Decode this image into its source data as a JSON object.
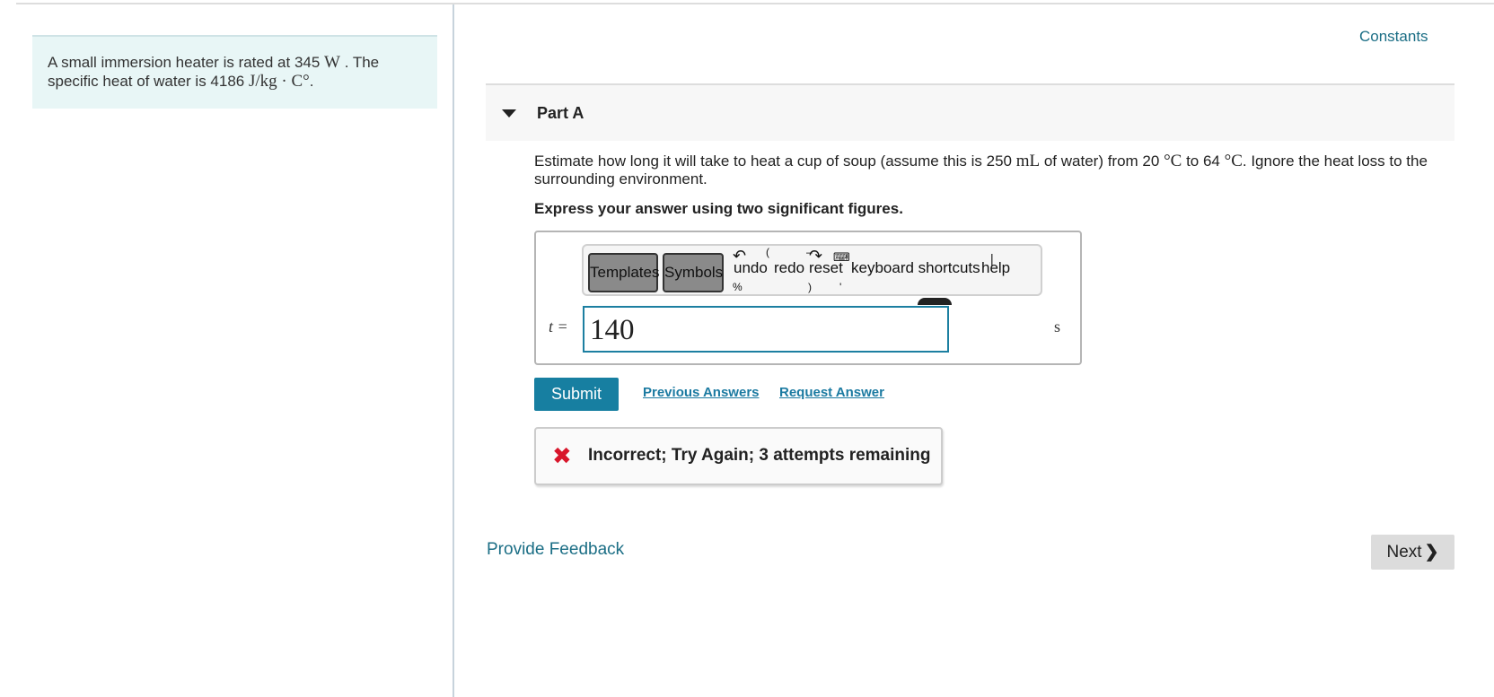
{
  "problem": {
    "pre": "A small immersion heater is rated at 345 ",
    "power_unit": "W",
    "mid": " . The specific heat of water is 4186 ",
    "heat_unit": "J/kg · C°",
    "end": "."
  },
  "constants_link": "Constants",
  "part": {
    "title": "Part A",
    "question": {
      "t1": "Estimate how long it will take to heat a cup of soup (assume this is 250 ",
      "u1": "mL",
      "t2": " of water) from 20 ",
      "u2": "°C",
      "t3": " to 64 ",
      "u3": "°C",
      "t4": ". Ignore the heat loss to the surrounding environment."
    },
    "instructions": "Express your answer using two significant figures."
  },
  "toolbar": {
    "templates": "Templates",
    "symbols": "Symbols",
    "undo": "undo",
    "redo": "redo",
    "reset": "reset",
    "keyboard": "keyboard shortcuts",
    "help": "help"
  },
  "answer": {
    "variable": "t =",
    "value": "140",
    "unit": "s"
  },
  "actions": {
    "submit": "Submit",
    "previous": "Previous Answers",
    "request": "Request Answer"
  },
  "feedback": {
    "message": "Incorrect; Try Again; 3 attempts remaining",
    "icon": "x-mark-icon",
    "icon_color": "#d8162b"
  },
  "footer": {
    "provide_feedback": "Provide Feedback",
    "next": "Next"
  },
  "colors": {
    "accent": "#177fa1",
    "info_bg": "#e8f6f6",
    "link": "#1b6e85"
  }
}
